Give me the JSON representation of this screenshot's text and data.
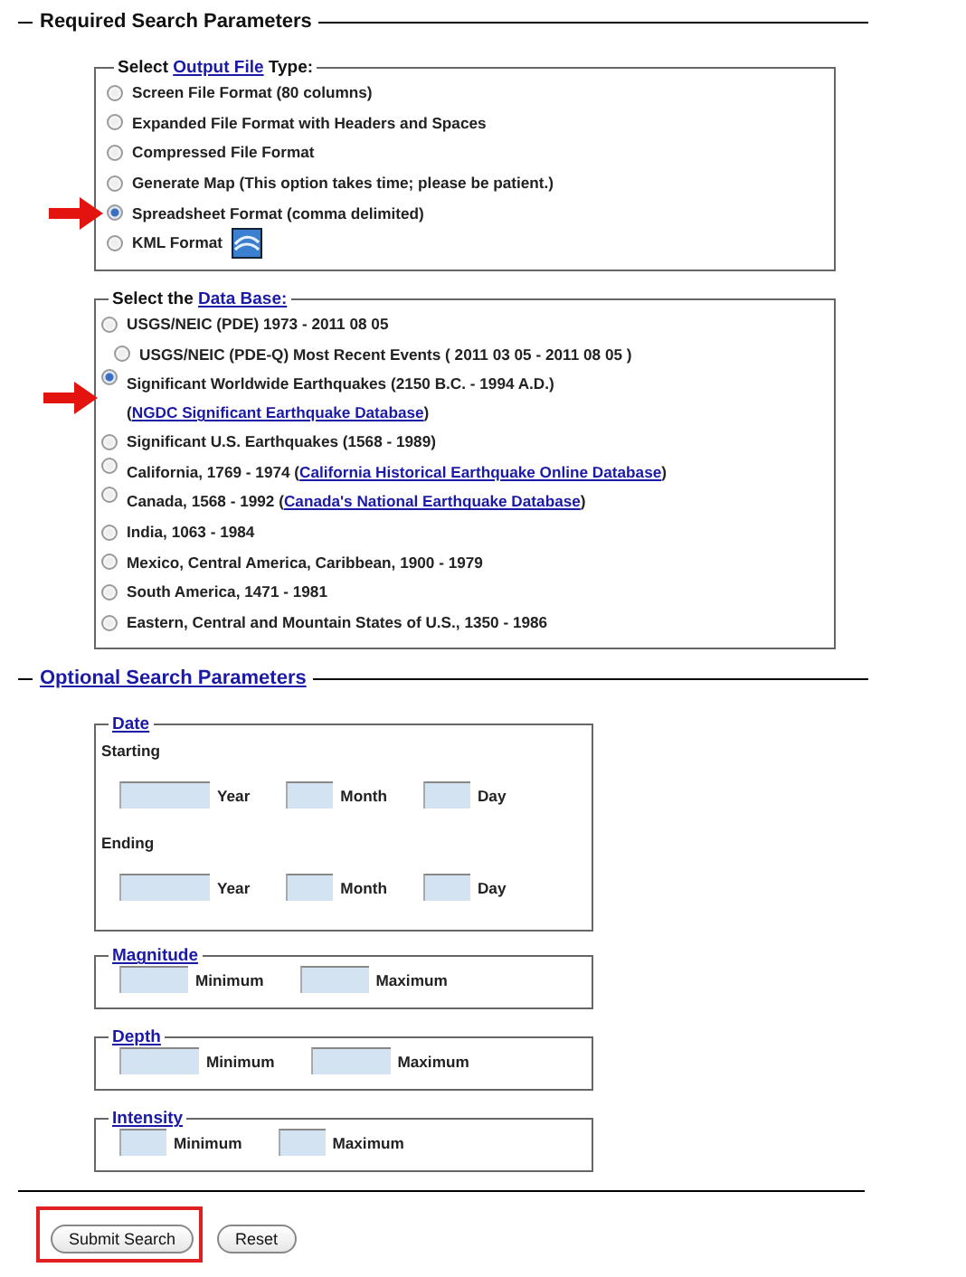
{
  "required": {
    "title": "Required Search Parameters",
    "output_file": {
      "legend_prefix": "Select ",
      "legend_link": "Output File",
      "legend_suffix": " Type:",
      "options": [
        {
          "label": "Screen File Format (80 columns)",
          "selected": false,
          "arrow": false
        },
        {
          "label": "Expanded File Format with Headers and Spaces",
          "selected": false,
          "arrow": false
        },
        {
          "label": "Compressed File Format",
          "selected": false,
          "arrow": false
        },
        {
          "label": "Generate Map (This option takes time; please be patient.)",
          "selected": false,
          "arrow": false
        },
        {
          "label": "Spreadsheet Format (comma delimited)",
          "selected": true,
          "arrow": true
        },
        {
          "label": "KML Format",
          "selected": false,
          "arrow": false,
          "kind": "icon"
        }
      ]
    },
    "database": {
      "legend_prefix": "Select the ",
      "legend_link": "Data Base:",
      "options": [
        {
          "kind": "main",
          "label": "USGS/NEIC (PDE) 1973 - 2011 08 05",
          "selected": false,
          "arrow": false
        },
        {
          "kind": "sub",
          "label": "USGS/NEIC (PDE-Q) Most Recent Events ( 2011 03 05 - 2011 08 05 )",
          "selected": false,
          "arrow": false
        },
        {
          "kind": "main",
          "label": "Significant Worldwide Earthquakes (2150 B.C. - 1994 A.D.) (",
          "link": "NGDC Significant Earthquake Database",
          "suffix": ")",
          "selected": true,
          "arrow": true
        },
        {
          "kind": "main",
          "label": "Significant U.S. Earthquakes (1568 - 1989)",
          "selected": false,
          "arrow": false
        },
        {
          "kind": "main",
          "label": "California, 1769 - 1974 (",
          "link": "California Historical Earthquake Online Database",
          "suffix": ")",
          "selected": false,
          "arrow": false
        },
        {
          "kind": "main",
          "label": "Canada, 1568 - 1992 (",
          "link": "Canada's National Earthquake Database",
          "suffix": ")",
          "selected": false,
          "arrow": false
        },
        {
          "kind": "main",
          "label": "India, 1063 - 1984",
          "selected": false,
          "arrow": false
        },
        {
          "kind": "main",
          "label": "Mexico, Central America, Caribbean, 1900 - 1979",
          "selected": false,
          "arrow": false
        },
        {
          "kind": "main",
          "label": "South America, 1471 - 1981",
          "selected": false,
          "arrow": false
        },
        {
          "kind": "main",
          "label": "Eastern, Central and Mountain States of U.S., 1350 - 1986",
          "selected": false,
          "arrow": false
        }
      ]
    }
  },
  "optional": {
    "title": "Optional Search Parameters",
    "groups": [
      {
        "kind": "date",
        "legend": "Date",
        "rows": [
          {
            "label": "Starting",
            "fields": [
              {
                "label": "Year"
              },
              {
                "label": "Month"
              },
              {
                "label": "Day"
              }
            ]
          },
          {
            "label": "Ending",
            "fields": [
              {
                "label": "Year"
              },
              {
                "label": "Month"
              },
              {
                "label": "Day"
              }
            ]
          }
        ]
      },
      {
        "kind": "range",
        "legend": "Magnitude",
        "fields": [
          {
            "label": "Minimum"
          },
          {
            "label": "Maximum"
          }
        ]
      },
      {
        "kind": "range",
        "legend": "Depth",
        "fields": [
          {
            "label": "Minimum"
          },
          {
            "label": "Maximum"
          }
        ]
      },
      {
        "kind": "range",
        "legend": "Intensity",
        "fields": [
          {
            "label": "Minimum"
          },
          {
            "label": "Maximum"
          }
        ]
      }
    ]
  },
  "buttons": [
    {
      "label": "Submit Search",
      "highlighted": true
    },
    {
      "label": "Reset",
      "highlighted": false
    }
  ]
}
